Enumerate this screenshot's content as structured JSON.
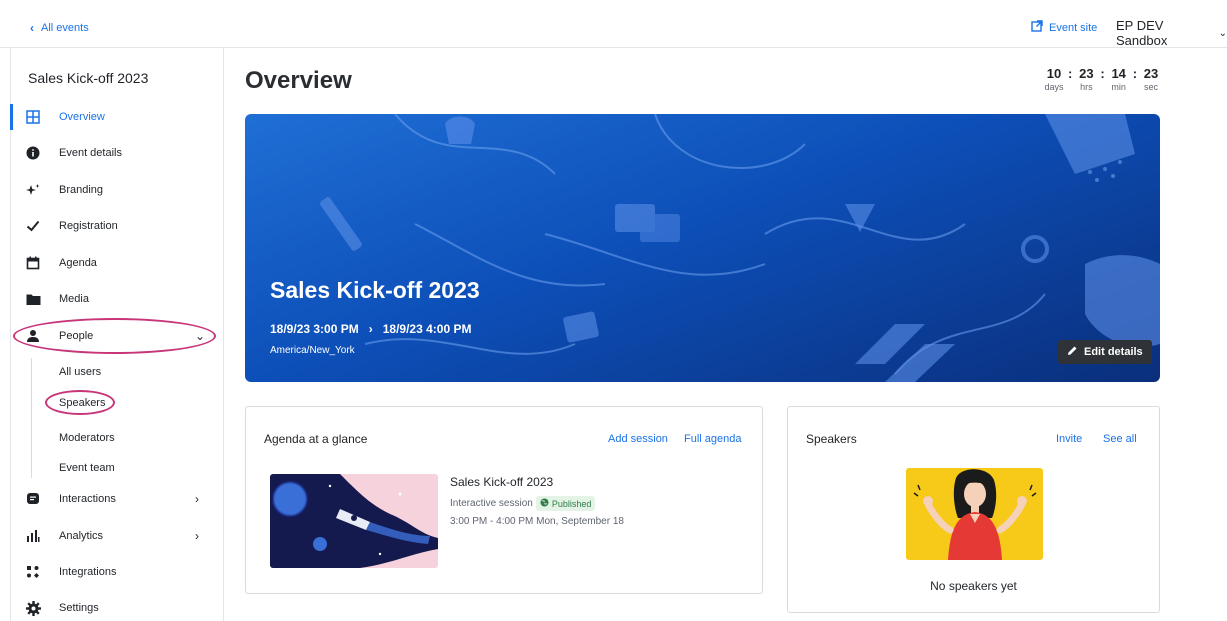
{
  "topbar": {
    "back_label": "All events",
    "event_site_label": "Event site",
    "org_label": "EP DEV Sandbox"
  },
  "sidebar": {
    "event_name": "Sales Kick-off 2023",
    "items": [
      {
        "label": "Overview",
        "icon": "grid-icon",
        "active": true
      },
      {
        "label": "Event details",
        "icon": "info-icon"
      },
      {
        "label": "Branding",
        "icon": "sparkle-icon"
      },
      {
        "label": "Registration",
        "icon": "check-icon"
      },
      {
        "label": "Agenda",
        "icon": "calendar-icon"
      },
      {
        "label": "Media",
        "icon": "folder-icon"
      },
      {
        "label": "People",
        "icon": "person-icon",
        "expanded": true
      },
      {
        "label": "Interactions",
        "icon": "chat-icon"
      },
      {
        "label": "Analytics",
        "icon": "bar-chart-icon"
      },
      {
        "label": "Integrations",
        "icon": "integrations-icon"
      },
      {
        "label": "Settings",
        "icon": "gear-icon"
      }
    ],
    "people_sub": [
      "All users",
      "Speakers",
      "Moderators",
      "Event team"
    ]
  },
  "main": {
    "title": "Overview",
    "countdown": {
      "days": "10",
      "hrs": "23",
      "min": "14",
      "sec": "23",
      "days_label": "days",
      "hrs_label": "hrs",
      "min_label": "min",
      "sec_label": "sec",
      "sep": ":"
    },
    "hero": {
      "title": "Sales Kick-off 2023",
      "start": "18/9/23 3:00 PM",
      "arrow": "›",
      "end": "18/9/23 4:00 PM",
      "timezone": "America/New_York",
      "edit_label": "Edit details"
    },
    "agenda": {
      "title": "Agenda at a glance",
      "add_session_label": "Add session",
      "full_agenda_label": "Full agenda",
      "session": {
        "title": "Sales Kick-off 2023",
        "type": "Interactive session",
        "status": "Published",
        "time": "3:00 PM - 4:00 PM Mon, September 18"
      }
    },
    "speakers": {
      "title": "Speakers",
      "invite_label": "Invite",
      "see_all_label": "See all",
      "empty_text": "No speakers yet"
    }
  },
  "colors": {
    "accent": "#1a73e8",
    "highlight_ring": "#c8367a",
    "hero_blue": "#0d4fb8",
    "published_green": "#2e7d45"
  }
}
